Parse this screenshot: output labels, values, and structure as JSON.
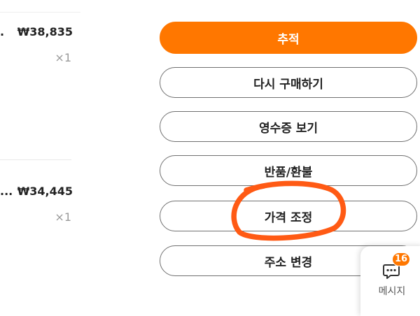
{
  "orders": [
    {
      "name_truncated": ".",
      "price": "₩38,835",
      "quantity": "×1"
    },
    {
      "name_truncated": "...",
      "price": "₩34,445",
      "quantity": "×1"
    }
  ],
  "actions": {
    "track": "추적",
    "buy_again": "다시 구매하기",
    "view_receipt": "영수증 보기",
    "return_refund": "반품/환불",
    "price_adjust": "가격 조정",
    "change_address": "주소 변경"
  },
  "messages": {
    "badge_count": "16",
    "label": "메시지"
  },
  "colors": {
    "accent": "#ff7700",
    "annotation": "#ff5a14",
    "border": "#707070",
    "muted": "#9a9a9a"
  },
  "annotation": {
    "type": "hand-drawn circle",
    "target": "가격 조정"
  },
  "icons": {
    "messages": "chat-bubble-icon"
  }
}
